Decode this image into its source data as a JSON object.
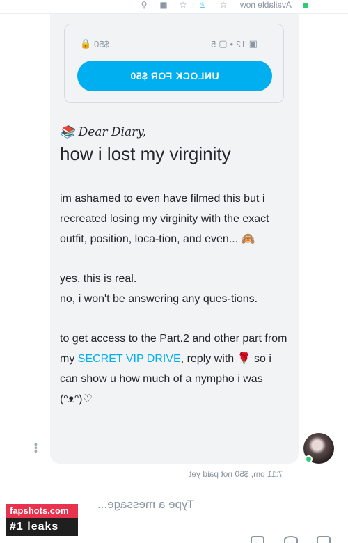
{
  "topbar": {
    "status_text": "Available now",
    "icons": [
      "star-icon",
      "bell-icon",
      "tag-icon",
      "image-icon",
      "search-icon"
    ]
  },
  "locked_post": {
    "image_count": "12",
    "separator": "•",
    "video_count": "5",
    "price": "$50",
    "unlock_label": "UNLOCK FOR $50"
  },
  "message": {
    "diary": "📚 Dear Diary,",
    "headline": "how i lost my virginity",
    "paragraph1": "im ashamed to even have filmed this but i recreated losing my virginity with the exact outfit, position, loca-tion, and even... 🙈",
    "paragraph2_line1": "yes, this is real.",
    "paragraph2_line2": "no, i won't be answering any ques-tions.",
    "paragraph3_before": "to get access to the Part.2 and other part from my ",
    "paragraph3_link": "SECRET VIP DRIVE",
    "paragraph3_after": ", reply with 🌹 so i can show u how much of a nympho i was (ᵔᴥᵔ)♡"
  },
  "timestamp": "7:11 pm, $50 not paid yet",
  "composer": {
    "placeholder": "Type a message..."
  },
  "watermark": {
    "site": "fapshots.com",
    "tagline": "#1 leaks"
  },
  "colors": {
    "accent": "#00aff0",
    "online": "#2ecc71",
    "bubble": "#f1f3f5",
    "watermark_red": "#e8324e"
  }
}
